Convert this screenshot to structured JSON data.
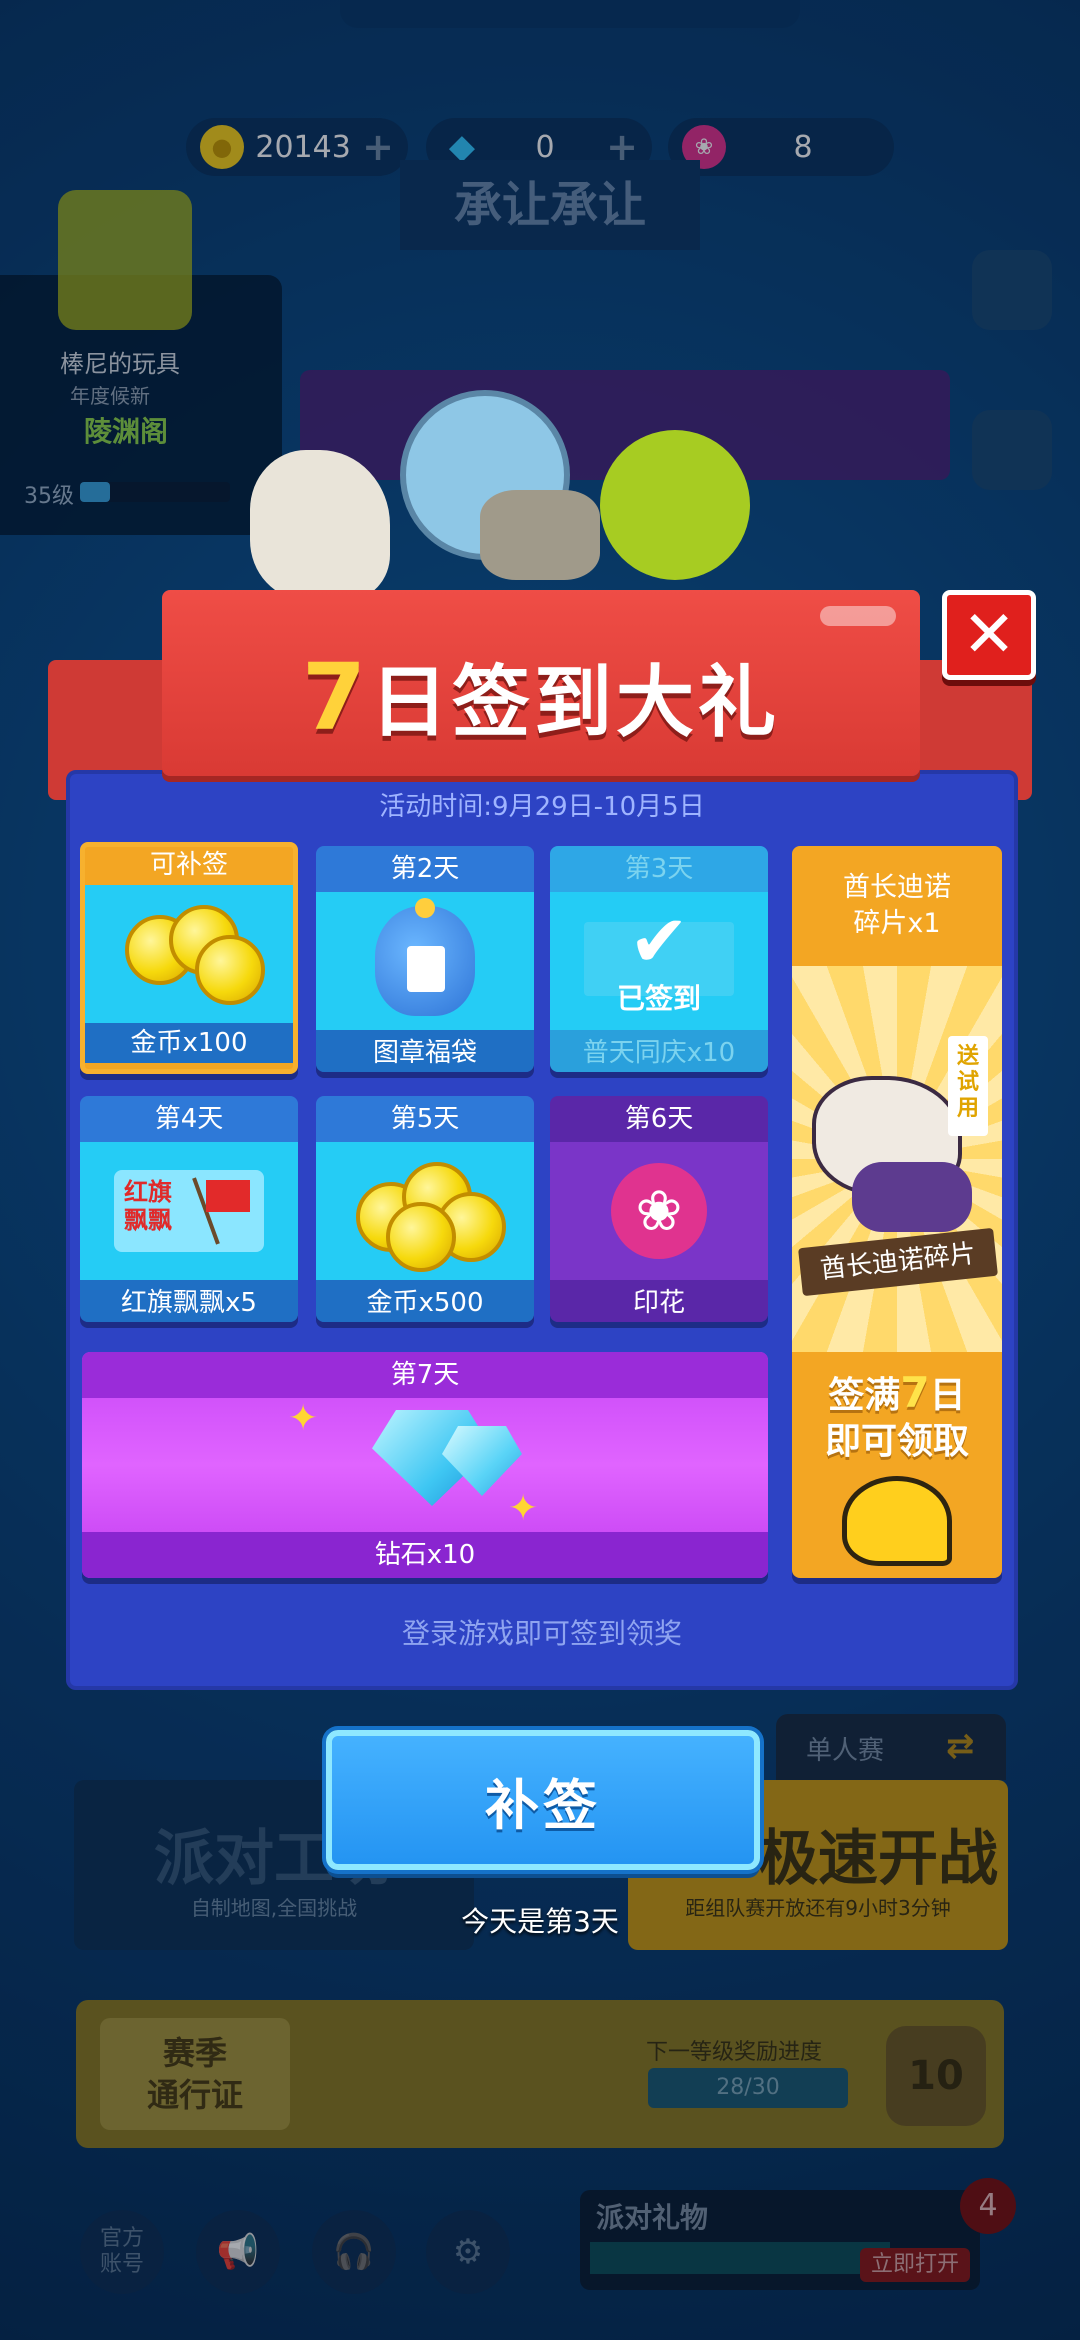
{
  "currency": {
    "coins": "20143",
    "diamonds": "0",
    "stamps": "8"
  },
  "background": {
    "title_banner": "承让承让",
    "profile": {
      "name": "棒尼的玩具",
      "sub": "年度候新",
      "guild": "陵渊阁",
      "level": "35级"
    },
    "mode_left": {
      "title": "派对工坊",
      "subtitle": "自制地图,全国挑战"
    },
    "mode_right": {
      "tab": "单人赛",
      "title": "极速开战",
      "subtitle": "距组队赛开放还有9小时3分钟"
    },
    "season": {
      "label": "赛季\n通行证",
      "next": "下一等级奖励进度",
      "progress": "28/30",
      "rank": "10"
    },
    "bottom": {
      "official": "官方\n账号",
      "gift_title": "派对礼物",
      "gift_open": "立即打开",
      "badge": "4"
    }
  },
  "modal": {
    "title_seven": "7",
    "title_rest": "日签到大礼",
    "event_time": "活动时间:9月29日-10月5日",
    "days": [
      {
        "head": "可补签",
        "reward": "金币x100",
        "state": "makeup"
      },
      {
        "head": "第2天",
        "reward": "图章福袋",
        "state": "available"
      },
      {
        "head": "第3天",
        "reward": "普天同庆x10",
        "state": "signed",
        "signed_text": "已签到"
      },
      {
        "head": "第4天",
        "reward": "红旗飘飘x5",
        "state": "available",
        "card_text": "红旗\n飘飘"
      },
      {
        "head": "第5天",
        "reward": "金币x500",
        "state": "available"
      },
      {
        "head": "第6天",
        "reward": "印花",
        "state": "available"
      }
    ],
    "day7": {
      "head": "第7天",
      "reward": "钻石x10"
    },
    "grand": {
      "head": "酋长迪诺\n碎片x1",
      "fragment_label": "酋长迪诺碎片",
      "trial_tag": "送试用",
      "claim_prefix": "签满",
      "claim_seven": "7",
      "claim_suffix": "日\n即可领取"
    },
    "footer_note": "登录游戏即可签到领奖",
    "makeup_button": "补签",
    "today_note": "今天是第3天"
  },
  "icons": {
    "close": "close-icon",
    "coin": "coin-icon",
    "diamond": "diamond-icon",
    "stamp": "lotus-stamp-icon"
  },
  "colors": {
    "modal_bg": "#2d43c4",
    "ribbon": "#ef4d46",
    "gold": "#f3a623",
    "button": "#2494f2"
  }
}
